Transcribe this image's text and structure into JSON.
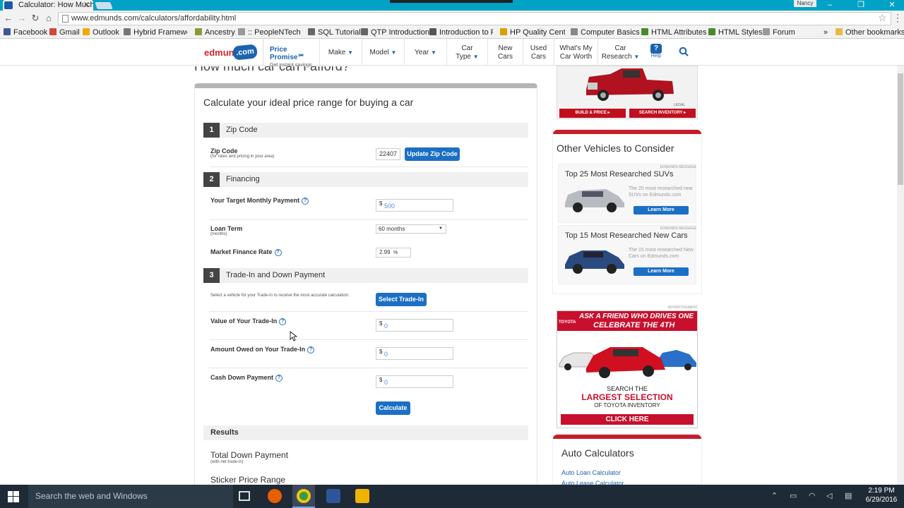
{
  "browser": {
    "tab_title": "Calculator: How Much",
    "user": "Nancy",
    "url": "www.edmunds.com/calculators/affordability.html",
    "bookmarks": [
      "Facebook",
      "Gmail",
      "Outlook",
      "Hybrid Framewor",
      "Ancestry",
      ":: PeopleNTech LL",
      "SQL Tutorial",
      "QTP Introduction",
      "Introduction to R",
      "HP Quality Cente",
      "Computer Basics",
      "HTML Attributes",
      "HTML Styles",
      "Forum"
    ],
    "bookmarks_overflow": "»",
    "other_bookmarks": "Other bookmarks"
  },
  "site": {
    "logo_left": "edmunds",
    "logo_right": ".com",
    "price_promise_title": "Price Promise℠",
    "price_promise_sub": "Get instant savings",
    "nav": [
      {
        "l1": "Make",
        "l2": ""
      },
      {
        "l1": "Model",
        "l2": ""
      },
      {
        "l1": "Year",
        "l2": ""
      },
      {
        "l1": "Car",
        "l2": "Type"
      },
      {
        "l1": "New",
        "l2": "Cars"
      },
      {
        "l1": "Used",
        "l2": "Cars"
      },
      {
        "l1": "What's My",
        "l2": "Car Worth"
      },
      {
        "l1": "Car",
        "l2": "Research"
      }
    ],
    "help": "Help"
  },
  "calc": {
    "page_title": "How much car can I afford?",
    "card_title": "Calculate your ideal price range for buying a car",
    "sections": [
      {
        "num": "1",
        "title": "Zip Code"
      },
      {
        "num": "2",
        "title": "Financing"
      },
      {
        "num": "3",
        "title": "Trade-In and Down Payment"
      }
    ],
    "zip_label": "Zip Code",
    "zip_sub": "(for rates and pricing in your area)",
    "zip_value": "22407",
    "zip_button": "Update Zip Code",
    "monthly_label": "Your Target Monthly Payment",
    "currency": "$",
    "monthly_value": "500",
    "loan_label": "Loan Term",
    "loan_sub": "(months)",
    "loan_value": "60 months",
    "rate_label": "Market Finance Rate",
    "rate_value": "2.99",
    "rate_unit": "%",
    "tradein_note": "Select a vehicle for your Trade-In to receive the most accurate calculation.",
    "tradein_button": "Select Trade-In",
    "value_label": "Value of Your Trade-In",
    "value_value": "0",
    "owed_label": "Amount Owed on Your Trade-In",
    "owed_value": "0",
    "cash_label": "Cash Down Payment",
    "cash_value": "0",
    "calc_button": "Calculate",
    "results_label": "Results",
    "total_down_label": "Total Down Payment",
    "total_down_sub": "(with net trade-in)",
    "sticker_label": "Sticker Price Range"
  },
  "sidebar": {
    "ad1_legal": "LEGAL",
    "ad1_btn1": "BUILD & PRICE ▸",
    "ad1_btn2": "SEARCH INVENTORY ▸",
    "other_title": "Other Vehicles to Consider",
    "msg_tag": "EDMUNDS MESSAGE",
    "items": [
      {
        "title": "Top 25 Most Researched SUVs",
        "desc": "The 25 most researched new SUVs on Edmunds.com",
        "btn": "Learn More"
      },
      {
        "title": "Top 15 Most Researched New Cars",
        "desc": "The 15 most researched New Cars on Edmunds.com",
        "btn": "Learn More"
      }
    ],
    "ad_tag": "ADVERTISEMENT",
    "ad2_brand": "TOYOTA",
    "ad2_headline": "ASK A FRIEND WHO DRIVES ONE",
    "ad2_celebrate": "CELEBRATE THE 4TH",
    "ad2_line1": "SEARCH THE",
    "ad2_line2": "LARGEST SELECTION",
    "ad2_line3": "OF TOYOTA INVENTORY",
    "ad2_cta": "CLICK HERE",
    "calc_title": "Auto Calculators",
    "calc_links": [
      "Auto Loan Calculator",
      "Auto Lease Calculator"
    ]
  },
  "taskbar": {
    "search_placeholder": "Search the web and Windows",
    "time": "2:19 PM",
    "date": "6/29/2016"
  }
}
